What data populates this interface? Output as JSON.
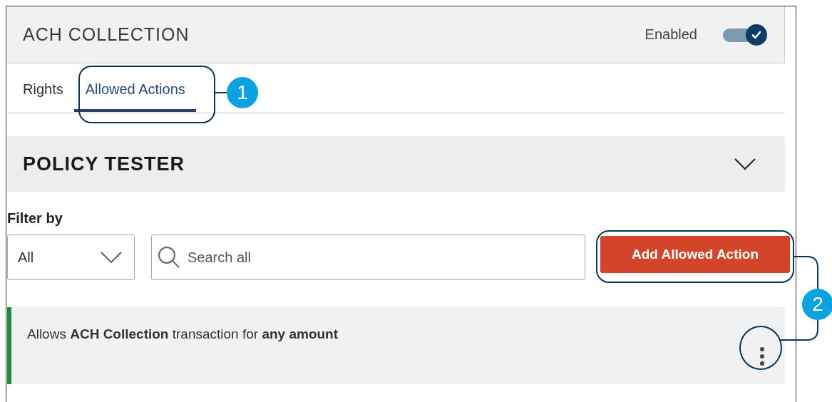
{
  "header": {
    "title": "ACH COLLECTION",
    "toggle": {
      "label": "Enabled",
      "on": true
    }
  },
  "tabs": [
    {
      "label": "Rights",
      "selected": false
    },
    {
      "label": "Allowed Actions",
      "selected": true
    }
  ],
  "section": {
    "title": "POLICY TESTER",
    "expanded": false
  },
  "filter": {
    "label": "Filter by",
    "select_value": "All",
    "search_placeholder": "Search all"
  },
  "add_button": "Add Allowed Action",
  "rules": [
    {
      "text": "Allows **ACH Collection** transaction for **any amount**"
    }
  ],
  "callouts": [
    {
      "number": "1"
    },
    {
      "number": "2"
    }
  ]
}
